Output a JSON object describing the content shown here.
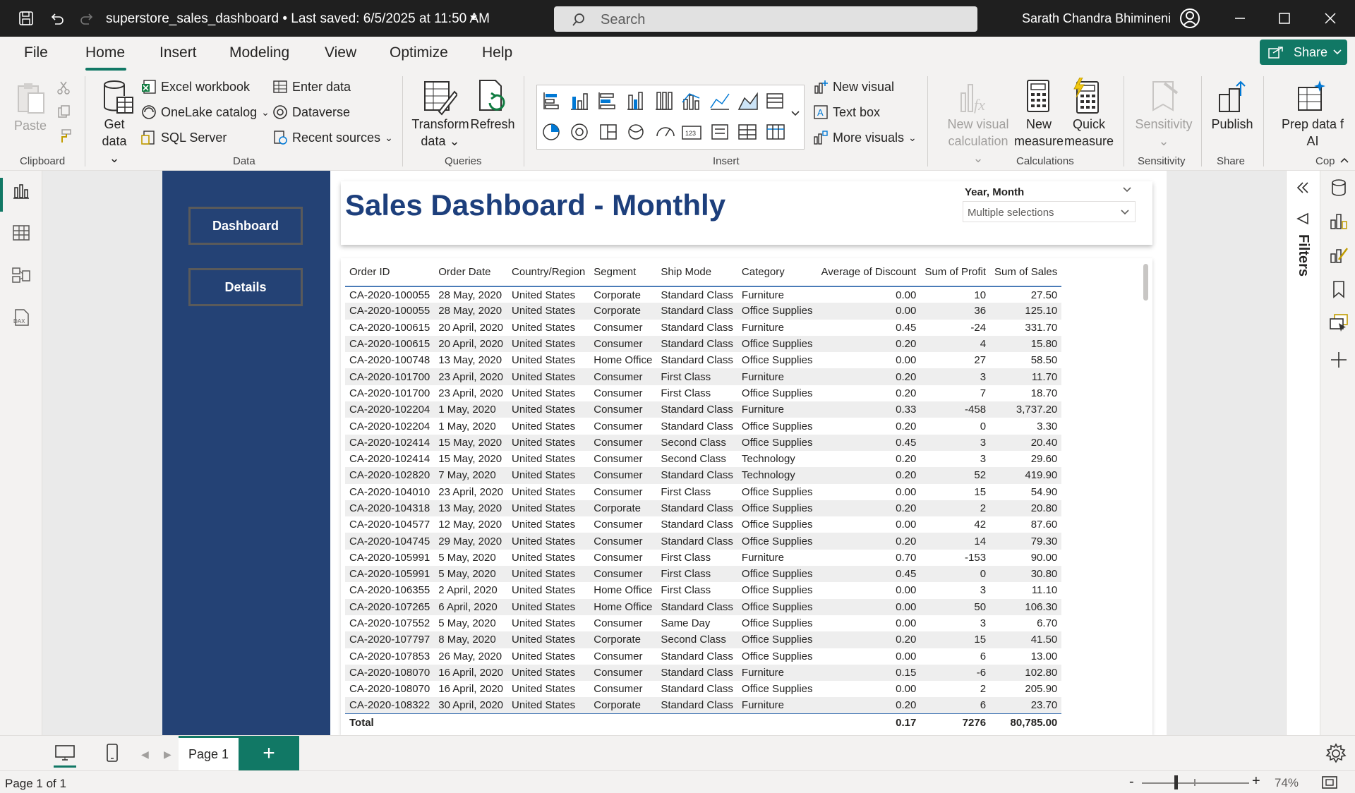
{
  "titlebar": {
    "title": "superstore_sales_dashboard • Last saved: 6/5/2025 at 11:50 AM",
    "search_placeholder": "Search",
    "user_name": "Sarath Chandra Bhimineni"
  },
  "menu": {
    "file": "File",
    "home": "Home",
    "insert": "Insert",
    "modeling": "Modeling",
    "view": "View",
    "optimize": "Optimize",
    "help": "Help",
    "share": "Share"
  },
  "ribbon": {
    "clipboard": {
      "label": "Clipboard",
      "paste": "Paste"
    },
    "data": {
      "label": "Data",
      "get_data_1": "Get",
      "get_data_2": "data",
      "excel": "Excel workbook",
      "onelake": "OneLake catalog",
      "sql": "SQL Server",
      "enter_data": "Enter data",
      "dataverse": "Dataverse",
      "recent": "Recent sources"
    },
    "queries": {
      "label": "Queries",
      "transform_1": "Transform",
      "transform_2": "data",
      "refresh": "Refresh"
    },
    "insert": {
      "label": "Insert",
      "new_visual": "New visual",
      "text_box": "Text box",
      "more_visuals": "More visuals"
    },
    "calculations": {
      "label": "Calculations",
      "new_visual_calc_1": "New visual",
      "new_visual_calc_2": "calculation",
      "new_measure_1": "New",
      "new_measure_2": "measure",
      "quick_measure_1": "Quick",
      "quick_measure_2": "measure"
    },
    "sensitivity": {
      "label": "Sensitivity",
      "button": "Sensitivity"
    },
    "share": {
      "label": "Share",
      "publish": "Publish"
    },
    "copilot": {
      "label": "Cop",
      "prep_1": "Prep data f",
      "prep_2": "AI"
    }
  },
  "report": {
    "nav_dashboard": "Dashboard",
    "nav_details": "Details",
    "title": "Sales Dashboard - Monthly",
    "slicer_label": "Year, Month",
    "slicer_value": "Multiple selections",
    "table": {
      "columns": [
        "Order ID",
        "Order Date",
        "Country/Region",
        "Segment",
        "Ship Mode",
        "Category",
        "Average of Discount",
        "Sum of Profit",
        "Sum of Sales"
      ],
      "rows": [
        [
          "CA-2020-100055",
          "28 May, 2020",
          "United States",
          "Corporate",
          "Standard Class",
          "Furniture",
          "0.00",
          "10",
          "27.50"
        ],
        [
          "CA-2020-100055",
          "28 May, 2020",
          "United States",
          "Corporate",
          "Standard Class",
          "Office Supplies",
          "0.00",
          "36",
          "125.10"
        ],
        [
          "CA-2020-100615",
          "20 April, 2020",
          "United States",
          "Consumer",
          "Standard Class",
          "Furniture",
          "0.45",
          "-24",
          "331.70"
        ],
        [
          "CA-2020-100615",
          "20 April, 2020",
          "United States",
          "Consumer",
          "Standard Class",
          "Office Supplies",
          "0.20",
          "4",
          "15.80"
        ],
        [
          "CA-2020-100748",
          "13 May, 2020",
          "United States",
          "Home Office",
          "Standard Class",
          "Office Supplies",
          "0.00",
          "27",
          "58.50"
        ],
        [
          "CA-2020-101700",
          "23 April, 2020",
          "United States",
          "Consumer",
          "First Class",
          "Furniture",
          "0.20",
          "3",
          "11.70"
        ],
        [
          "CA-2020-101700",
          "23 April, 2020",
          "United States",
          "Consumer",
          "First Class",
          "Office Supplies",
          "0.20",
          "7",
          "18.70"
        ],
        [
          "CA-2020-102204",
          "1 May, 2020",
          "United States",
          "Consumer",
          "Standard Class",
          "Furniture",
          "0.33",
          "-458",
          "3,737.20"
        ],
        [
          "CA-2020-102204",
          "1 May, 2020",
          "United States",
          "Consumer",
          "Standard Class",
          "Office Supplies",
          "0.20",
          "0",
          "3.30"
        ],
        [
          "CA-2020-102414",
          "15 May, 2020",
          "United States",
          "Consumer",
          "Second Class",
          "Office Supplies",
          "0.45",
          "3",
          "20.40"
        ],
        [
          "CA-2020-102414",
          "15 May, 2020",
          "United States",
          "Consumer",
          "Second Class",
          "Technology",
          "0.20",
          "3",
          "29.60"
        ],
        [
          "CA-2020-102820",
          "7 May, 2020",
          "United States",
          "Consumer",
          "Standard Class",
          "Technology",
          "0.20",
          "52",
          "419.90"
        ],
        [
          "CA-2020-104010",
          "23 April, 2020",
          "United States",
          "Consumer",
          "First Class",
          "Office Supplies",
          "0.00",
          "15",
          "54.90"
        ],
        [
          "CA-2020-104318",
          "13 May, 2020",
          "United States",
          "Corporate",
          "Standard Class",
          "Office Supplies",
          "0.20",
          "2",
          "20.80"
        ],
        [
          "CA-2020-104577",
          "12 May, 2020",
          "United States",
          "Consumer",
          "Standard Class",
          "Office Supplies",
          "0.00",
          "42",
          "87.60"
        ],
        [
          "CA-2020-104745",
          "29 May, 2020",
          "United States",
          "Consumer",
          "Standard Class",
          "Office Supplies",
          "0.20",
          "14",
          "79.30"
        ],
        [
          "CA-2020-105991",
          "5 May, 2020",
          "United States",
          "Consumer",
          "First Class",
          "Furniture",
          "0.70",
          "-153",
          "90.00"
        ],
        [
          "CA-2020-105991",
          "5 May, 2020",
          "United States",
          "Consumer",
          "First Class",
          "Office Supplies",
          "0.45",
          "0",
          "30.80"
        ],
        [
          "CA-2020-106355",
          "2 April, 2020",
          "United States",
          "Home Office",
          "First Class",
          "Office Supplies",
          "0.00",
          "3",
          "11.10"
        ],
        [
          "CA-2020-107265",
          "6 April, 2020",
          "United States",
          "Home Office",
          "Standard Class",
          "Office Supplies",
          "0.00",
          "50",
          "106.30"
        ],
        [
          "CA-2020-107552",
          "5 May, 2020",
          "United States",
          "Consumer",
          "Same Day",
          "Office Supplies",
          "0.00",
          "3",
          "6.70"
        ],
        [
          "CA-2020-107797",
          "8 May, 2020",
          "United States",
          "Corporate",
          "Second Class",
          "Office Supplies",
          "0.20",
          "15",
          "41.50"
        ],
        [
          "CA-2020-107853",
          "26 May, 2020",
          "United States",
          "Consumer",
          "Standard Class",
          "Office Supplies",
          "0.00",
          "6",
          "13.00"
        ],
        [
          "CA-2020-108070",
          "16 April, 2020",
          "United States",
          "Consumer",
          "Standard Class",
          "Furniture",
          "0.15",
          "-6",
          "102.80"
        ],
        [
          "CA-2020-108070",
          "16 April, 2020",
          "United States",
          "Consumer",
          "Standard Class",
          "Office Supplies",
          "0.00",
          "2",
          "205.90"
        ],
        [
          "CA-2020-108322",
          "30 April, 2020",
          "United States",
          "Corporate",
          "Standard Class",
          "Furniture",
          "0.20",
          "6",
          "23.70"
        ]
      ],
      "total_label": "Total",
      "total_discount": "0.17",
      "total_profit": "7276",
      "total_sales": "80,785.00"
    }
  },
  "filters_label": "Filters",
  "pages": {
    "tab": "Page 1",
    "add": "+"
  },
  "status": {
    "page_info": "Page 1 of 1",
    "zoom": "74%",
    "zoom_fraction": 0.74
  },
  "colors": {
    "accent": "#117865",
    "report_nav": "#244275",
    "title_blue": "#1d3f7c"
  }
}
